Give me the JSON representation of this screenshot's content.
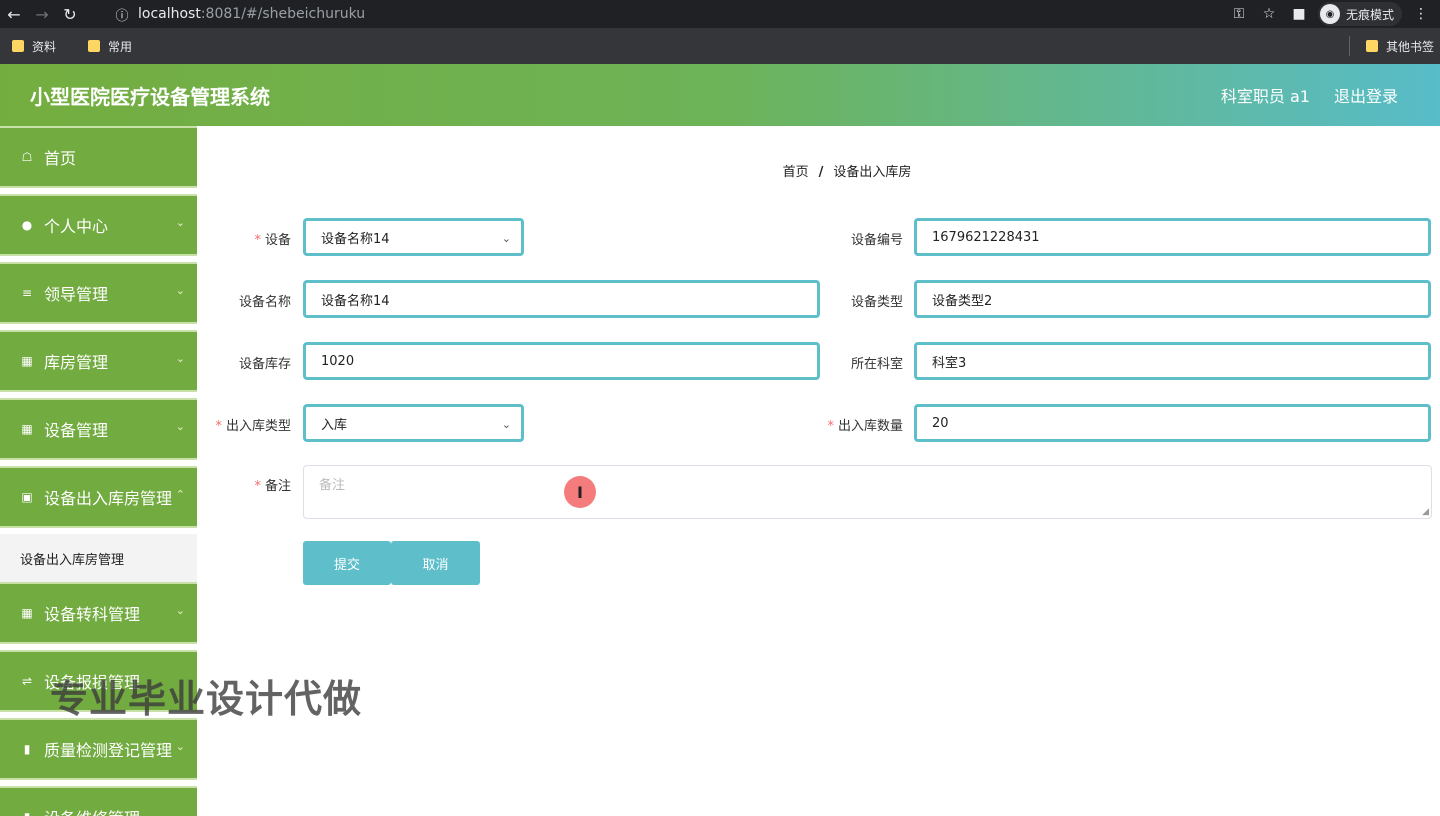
{
  "browser": {
    "url_host": "localhost",
    "url_rest": ":8081/#/shebeichuruku",
    "incognito_label": "无痕模式",
    "bookmarks": [
      "资料",
      "常用"
    ],
    "other_bookmarks": "其他书签"
  },
  "header": {
    "title": "小型医院医疗设备管理系统",
    "user": "科室职员 a1",
    "logout": "退出登录"
  },
  "sidebar": {
    "items": [
      {
        "label": "首页",
        "icon": "home-icon"
      },
      {
        "label": "个人中心",
        "icon": "user-icon"
      },
      {
        "label": "领导管理",
        "icon": "list-icon"
      },
      {
        "label": "库房管理",
        "icon": "grid-icon"
      },
      {
        "label": "设备管理",
        "icon": "grid-icon"
      },
      {
        "label": "设备出入库房管理",
        "icon": "briefcase-icon"
      },
      {
        "label": "设备转科管理",
        "icon": "grid-icon"
      },
      {
        "label": "设备报损管理",
        "icon": "sliders-icon"
      },
      {
        "label": "质量检测登记管理",
        "icon": "bar-chart-icon"
      },
      {
        "label": "设备维修管理",
        "icon": "bar-chart-icon"
      }
    ],
    "submenu_label": "设备出入库房管理"
  },
  "breadcrumb": {
    "home": "首页",
    "current": "设备出入库房"
  },
  "form": {
    "device_label": "设备",
    "device_value": "设备名称14",
    "code_label": "设备编号",
    "code_value": "1679621228431",
    "name_label": "设备名称",
    "name_value": "设备名称14",
    "type_label": "设备类型",
    "type_value": "设备类型2",
    "stock_label": "设备库存",
    "stock_value": "1020",
    "dept_label": "所在科室",
    "dept_value": "科室3",
    "io_type_label": "出入库类型",
    "io_type_value": "入库",
    "io_qty_label": "出入库数量",
    "io_qty_value": "20",
    "remark_label": "备注",
    "remark_placeholder": "备注",
    "submit": "提交",
    "cancel": "取消"
  },
  "watermark": "专业毕业设计代做",
  "colors": {
    "sidebar": "#72ab40",
    "accent": "#5ebfca",
    "required": "#f56c6c"
  }
}
